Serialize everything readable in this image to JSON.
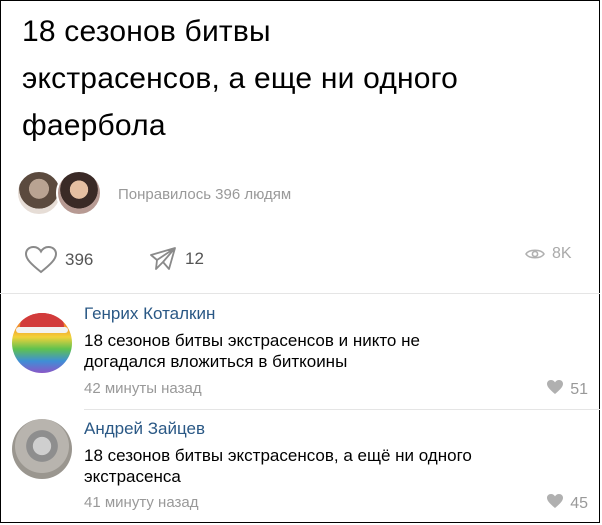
{
  "post": {
    "text_lines": [
      "18 сезонов битвы",
      "экстрасенсов, а еще ни одного",
      "фаербола"
    ],
    "liked_by_text": "Понравилось 396 людям",
    "likes_count": "396",
    "reposts_count": "12",
    "views_count": "8K"
  },
  "comments": [
    {
      "author": "Генрих Коталкин",
      "text_lines": [
        "18 сезонов битвы экстрасенсов и никто не",
        "догадался вложиться в биткоины"
      ],
      "time": "42 минуты назад",
      "likes": "51"
    },
    {
      "author": "Андрей Зайцев",
      "text_lines": [
        "18 сезонов битвы экстрасенсов, а ещё ни одного",
        "экстрасенса"
      ],
      "time": "41 минуту назад",
      "likes": "45"
    }
  ],
  "colors": {
    "link": "#2a5885",
    "muted": "#999999",
    "icon": "#b0b0b0"
  }
}
